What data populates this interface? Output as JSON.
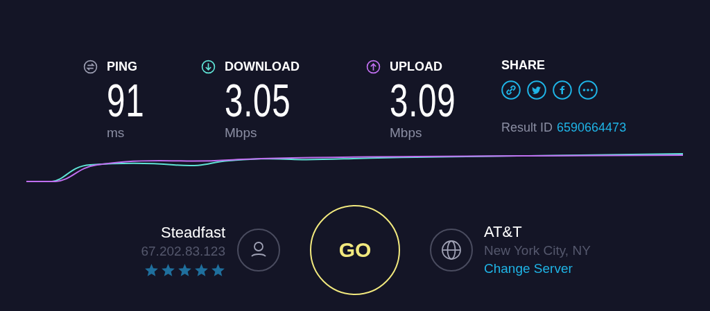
{
  "metrics": [
    {
      "kind": "ping",
      "label": "PING",
      "value": "91",
      "unit": "ms",
      "color": "#9a9cb0"
    },
    {
      "kind": "download",
      "label": "DOWNLOAD",
      "value": "3.05",
      "unit": "Mbps",
      "color": "#5fe3d5"
    },
    {
      "kind": "upload",
      "label": "UPLOAD",
      "value": "3.09",
      "unit": "Mbps",
      "color": "#c06ff0"
    }
  ],
  "share": {
    "title": "SHARE",
    "result_label": "Result ID",
    "result_id": "6590664473"
  },
  "isp": {
    "name": "Steadfast",
    "ip": "67.202.83.123",
    "stars": 5
  },
  "go_button": "GO",
  "server": {
    "name": "AT&T",
    "location": "New York City, NY",
    "change_link": "Change Server"
  }
}
